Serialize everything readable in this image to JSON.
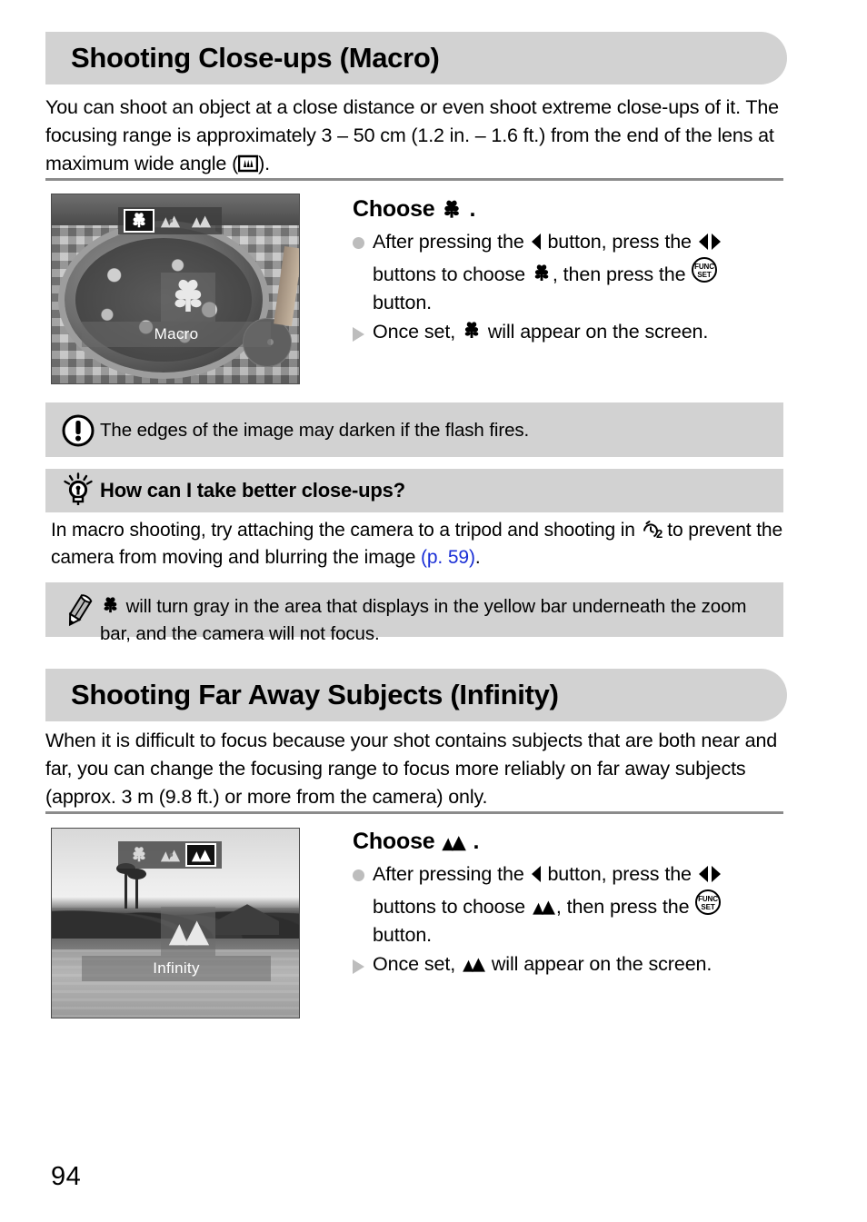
{
  "page": {
    "number": "94"
  },
  "sections": [
    {
      "id": "macro",
      "heading": "Shooting Close-ups (Macro)",
      "intro": "You can shoot an object at a close distance or even shoot extreme close-ups of it. The focusing range is approximately 3 – 50 cm (1.2 in. – 1.6 ft.) from the end of the lens at maximum wide angle (",
      "intro_tail": ").",
      "intro_icon": "wide-angle-zoom-icon",
      "screenshot": {
        "name": "camera-lcd-macro",
        "scene": "pizza-on-checkered-tablecloth",
        "mode_options": [
          "macro-icon",
          "normal-focus-icon",
          "infinity-icon"
        ],
        "selected_index": 0,
        "label": "Macro"
      },
      "instruction": {
        "title_prefix": "Choose",
        "title_icon": "macro-icon",
        "title_suffix": ".",
        "steps": [
          {
            "marker": "bullet",
            "parts": [
              {
                "t": "After pressing the "
              },
              {
                "icon": "left-arrow-button-icon"
              },
              {
                "t": " button, press the "
              },
              {
                "icon": "left-right-arrow-buttons-icon"
              },
              {
                "t": " buttons to choose "
              },
              {
                "icon": "macro-icon"
              },
              {
                "t": ", then press the "
              },
              {
                "icon": "func-set-button-icon"
              },
              {
                "t": " button."
              }
            ]
          },
          {
            "marker": "triangle",
            "parts": [
              {
                "t": "Once set, "
              },
              {
                "icon": "macro-icon"
              },
              {
                "t": " will appear on the screen."
              }
            ]
          }
        ]
      },
      "notes": [
        {
          "type": "caution",
          "icon": "exclamation-circle-icon",
          "text": "The edges of the image may darken if the flash fires."
        }
      ],
      "tip": {
        "icon": "lightbulb-icon",
        "heading": "How can I take better close-ups?",
        "body_parts": [
          {
            "t": "In macro shooting, try attaching the camera to a tripod and shooting in "
          },
          {
            "icon": "self-timer-2sec-icon"
          },
          {
            "t": " to prevent the camera from moving and blurring the image "
          },
          {
            "link": "(p. 59)"
          },
          {
            "t": "."
          }
        ]
      },
      "memo": {
        "icon": "pencil-icon",
        "body_parts": [
          {
            "icon": "macro-icon"
          },
          {
            "t": " will turn gray in the area that displays in the yellow bar underneath the zoom bar, and the camera will not focus."
          }
        ]
      }
    },
    {
      "id": "infinity",
      "heading": "Shooting Far Away Subjects (Infinity)",
      "intro": "When it is difficult to focus because your shot contains subjects that are both near and far, you can change the focusing range to focus more reliably on far away subjects (approx. 3 m (9.8 ft.) or more from the camera) only.",
      "screenshot": {
        "name": "camera-lcd-infinity",
        "scene": "tropical-landscape-with-water-and-hut",
        "mode_options": [
          "macro-icon",
          "normal-focus-icon",
          "infinity-icon"
        ],
        "selected_index": 2,
        "label": "Infinity"
      },
      "instruction": {
        "title_prefix": "Choose",
        "title_icon": "infinity-icon",
        "title_suffix": ".",
        "steps": [
          {
            "marker": "bullet",
            "parts": [
              {
                "t": "After pressing the "
              },
              {
                "icon": "left-arrow-button-icon"
              },
              {
                "t": " button, press the "
              },
              {
                "icon": "left-right-arrow-buttons-icon"
              },
              {
                "t": " buttons to choose "
              },
              {
                "icon": "infinity-icon"
              },
              {
                "t": ", then press the "
              },
              {
                "icon": "func-set-button-icon"
              },
              {
                "t": " button."
              }
            ]
          },
          {
            "marker": "triangle",
            "parts": [
              {
                "t": "Once set, "
              },
              {
                "icon": "infinity-icon"
              },
              {
                "t": " will appear on the screen."
              }
            ]
          }
        ]
      }
    }
  ],
  "colors": {
    "bar_gray": "#d2d2d2",
    "rule_gray": "#8b8b8b",
    "marker_gray": "#bdbdbd",
    "link_blue": "#1a2fd6"
  }
}
